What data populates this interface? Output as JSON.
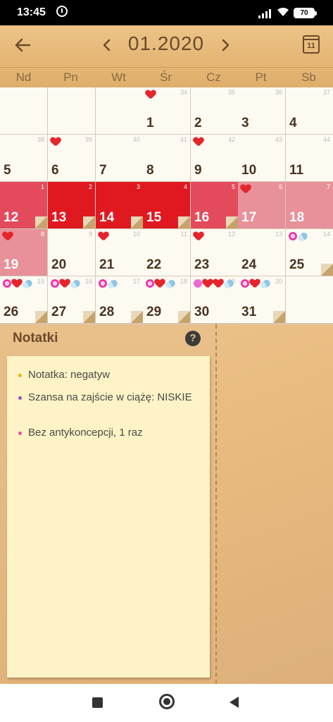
{
  "status_bar": {
    "time": "13:45",
    "battery": "70"
  },
  "header": {
    "title": "01.2020",
    "calendar_icon_day": "11",
    "weekdays": [
      "Nd",
      "Pn",
      "Wt",
      "Śr",
      "Cz",
      "Pt",
      "Sb"
    ]
  },
  "calendar": {
    "cells": [
      {
        "day": "",
        "week": ""
      },
      {
        "day": "",
        "week": ""
      },
      {
        "day": "",
        "week": ""
      },
      {
        "day": "1",
        "week": "34"
      },
      {
        "day": "2",
        "week": "35"
      },
      {
        "day": "3",
        "week": "36"
      },
      {
        "day": "4",
        "week": "37"
      },
      {
        "day": "5",
        "week": "38"
      },
      {
        "day": "6",
        "week": "39"
      },
      {
        "day": "7",
        "week": "40"
      },
      {
        "day": "8",
        "week": "41"
      },
      {
        "day": "9",
        "week": "42"
      },
      {
        "day": "10",
        "week": "43"
      },
      {
        "day": "11",
        "week": "44"
      },
      {
        "day": "12",
        "week": "1"
      },
      {
        "day": "13",
        "week": "2"
      },
      {
        "day": "14",
        "week": "3"
      },
      {
        "day": "15",
        "week": "4"
      },
      {
        "day": "16",
        "week": "5"
      },
      {
        "day": "17",
        "week": "6"
      },
      {
        "day": "18",
        "week": "7"
      },
      {
        "day": "19",
        "week": "8"
      },
      {
        "day": "20",
        "week": "9"
      },
      {
        "day": "21",
        "week": "10"
      },
      {
        "day": "22",
        "week": "11"
      },
      {
        "day": "23",
        "week": "12"
      },
      {
        "day": "24",
        "week": "13"
      },
      {
        "day": "25",
        "week": "14"
      },
      {
        "day": "26",
        "week": "15"
      },
      {
        "day": "27",
        "week": "16"
      },
      {
        "day": "28",
        "week": "17"
      },
      {
        "day": "29",
        "week": "18"
      },
      {
        "day": "30",
        "week": "19"
      },
      {
        "day": "31",
        "week": "20"
      },
      {
        "day": "",
        "week": ""
      }
    ]
  },
  "notes": {
    "title": "Notatki",
    "help": "?",
    "items": [
      {
        "text": "Notatka:  negatyw",
        "bullet_color": "#f0b400"
      },
      {
        "text": "Szansa na zajście w ciążę: NISKIE",
        "bullet_color": "#9c4fc0"
      },
      {
        "text": "Bez antykoncepcji, 1 raz",
        "bullet_color": "#e8559a"
      }
    ]
  },
  "colors": {
    "period_dark": "#e01820",
    "period_mid": "#e34b5d",
    "period_light": "#e8919a",
    "text_brown": "#6b4a2a"
  }
}
